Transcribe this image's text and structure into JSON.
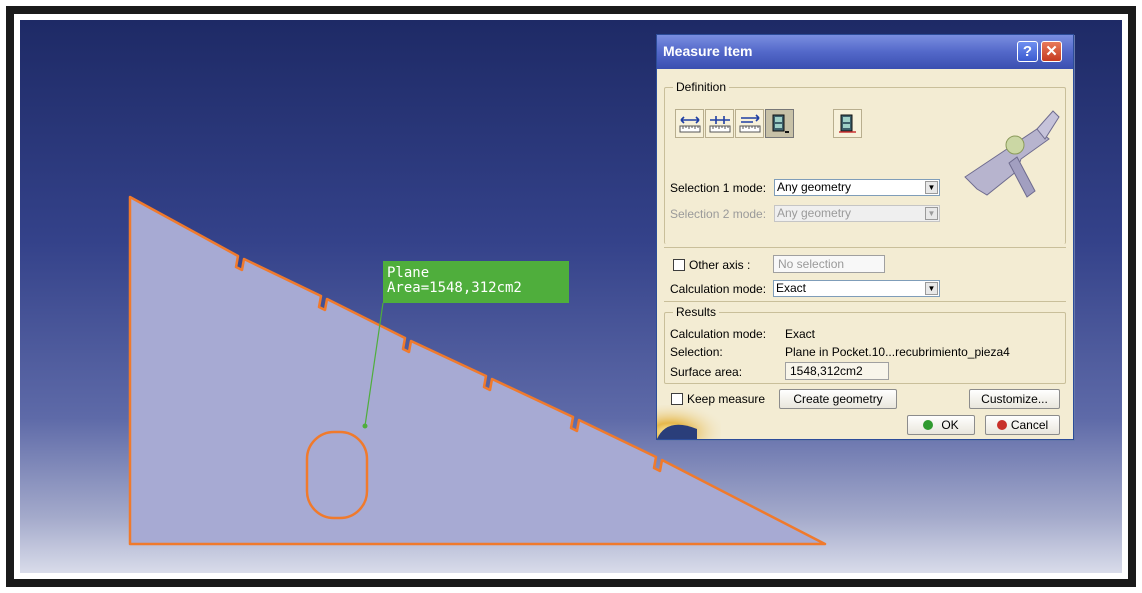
{
  "callout": {
    "line1": "Plane",
    "line2": "Area=1548,312cm2"
  },
  "dialog": {
    "title": "Measure Item",
    "help_glyph": "?",
    "close_glyph": "✕",
    "definition": {
      "label": "Definition",
      "tools": [
        "measure-between-icon",
        "measure-item-chain-icon",
        "measure-between-fan-icon",
        "measure-item-icon",
        "measure-thickness-icon"
      ],
      "selection1_label": "Selection 1 mode:",
      "selection1_value": "Any geometry",
      "selection2_label": "Selection 2 mode:",
      "selection2_value": "Any geometry"
    },
    "other_axis_label": "Other axis :",
    "other_axis_value": "No selection",
    "calc_mode_label": "Calculation mode:",
    "calc_mode_value": "Exact",
    "results": {
      "label": "Results",
      "calc_mode_label": "Calculation mode:",
      "calc_mode_value": "Exact",
      "selection_label": "Selection:",
      "selection_value": "Plane in Pocket.10...recubrimiento_pieza4",
      "surface_area_label": "Surface area:",
      "surface_area_value": "1548,312cm2"
    },
    "keep_measure_label": "Keep measure",
    "create_geometry_label": "Create geometry",
    "customize_label": "Customize...",
    "ok_label": "OK",
    "cancel_label": "Cancel"
  },
  "colors": {
    "part_fill": "#a7aad3",
    "part_edge": "#f07a2c",
    "callout_bg": "#4fae3c",
    "dialog_bg": "#f3ecd3",
    "titlebar": "#5368c9"
  }
}
